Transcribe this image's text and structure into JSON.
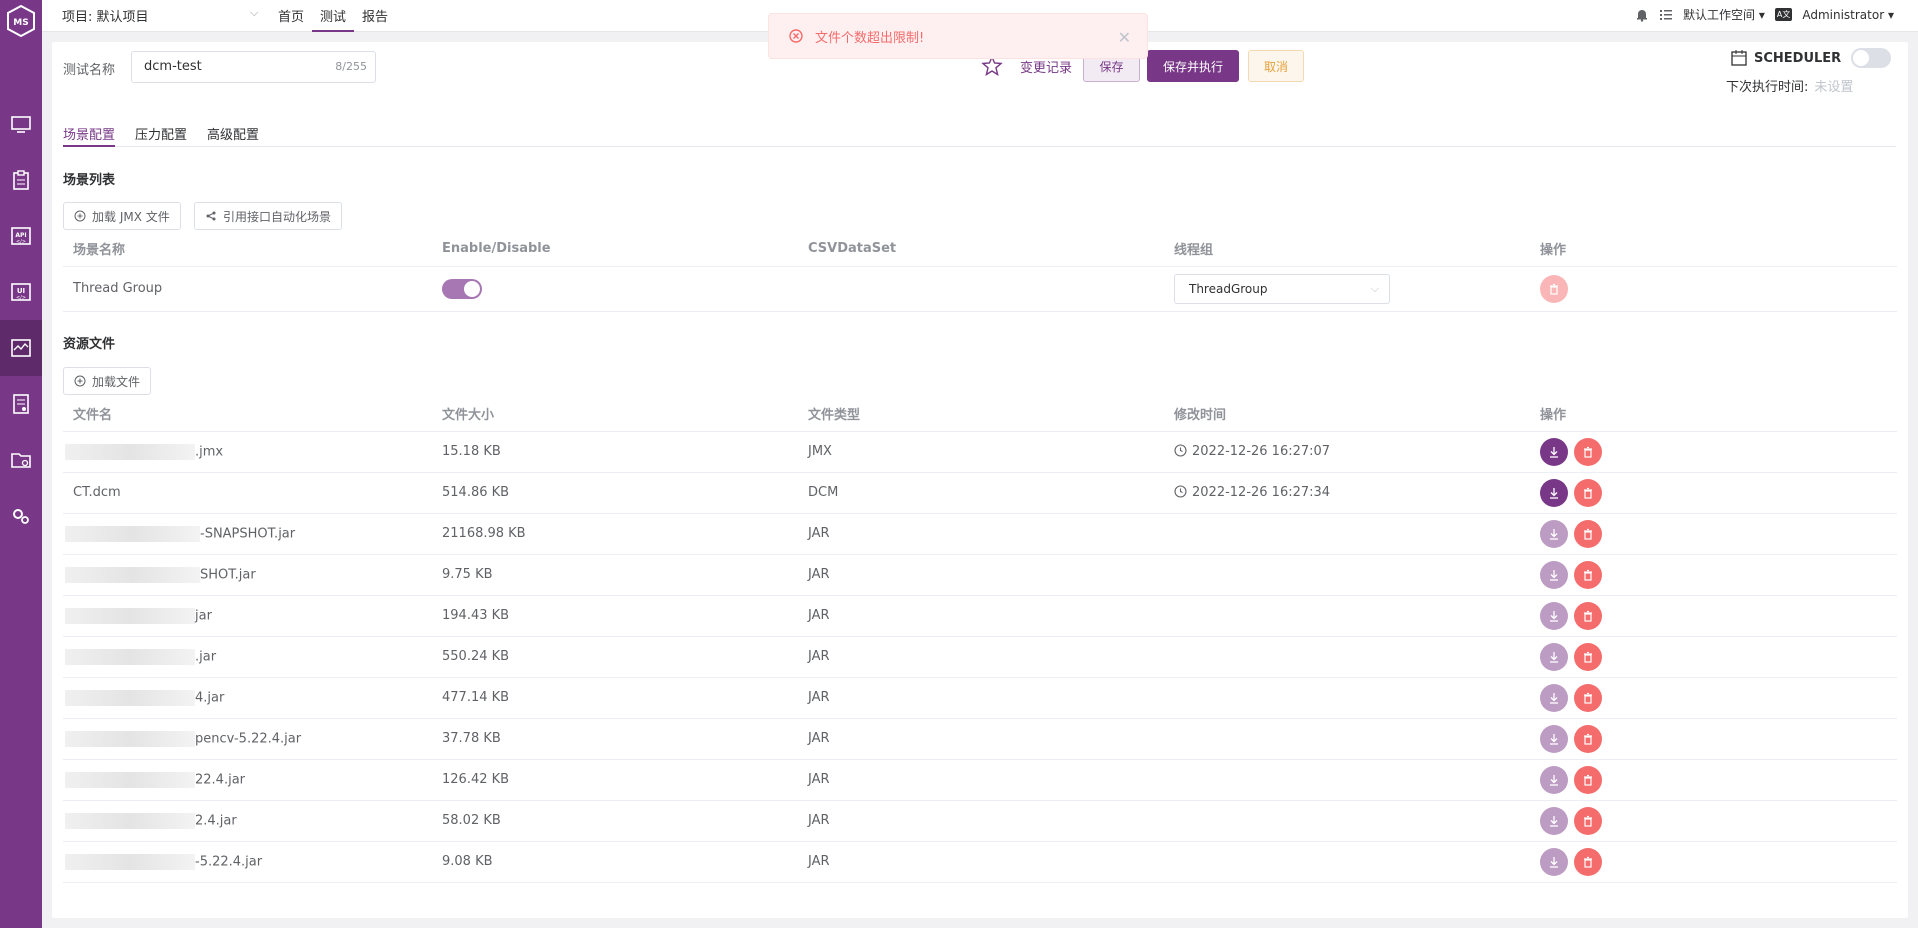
{
  "rail": {
    "logo_text": "MS"
  },
  "topbar": {
    "project_label": "项目: 默认项目",
    "nav": [
      "首页",
      "测试",
      "报告"
    ],
    "workspace": "默认工作空间",
    "user": "Administrator",
    "lang_badge": "A文"
  },
  "alert": {
    "message": "文件个数超出限制!"
  },
  "form": {
    "name_label": "测试名称",
    "name_value": "dcm-test",
    "name_count": "8/255",
    "history_label": "变更记录",
    "save_label": "保存",
    "save_run_label": "保存并执行",
    "cancel_label": "取消"
  },
  "scheduler": {
    "title": "SCHEDULER",
    "next_run_label": "下次执行时间:",
    "next_run_value": "未设置"
  },
  "tabs": [
    "场景配置",
    "压力配置",
    "高级配置"
  ],
  "scenarios": {
    "title": "场景列表",
    "load_jmx_label": "加载 JMX 文件",
    "reference_label": "引用接口自动化场景",
    "headers": [
      "场景名称",
      "Enable/Disable",
      "CSVDataSet",
      "线程组",
      "操作"
    ],
    "rows": [
      {
        "name": "Thread Group",
        "enabled": true,
        "csv": "",
        "thread_group": "ThreadGroup"
      }
    ]
  },
  "resources": {
    "title": "资源文件",
    "load_file_label": "加载文件",
    "headers": [
      "文件名",
      "文件大小",
      "文件类型",
      "修改时间",
      "操作"
    ],
    "rows": [
      {
        "name": ".jmx",
        "size": "15.18 KB",
        "type": "JMX",
        "time": "2022-12-26 16:27:07",
        "downloadable": true
      },
      {
        "name": "CT.dcm",
        "size": "514.86 KB",
        "type": "DCM",
        "time": "2022-12-26 16:27:34",
        "downloadable": true
      },
      {
        "name": "-SNAPSHOT.jar",
        "size": "21168.98 KB",
        "type": "JAR",
        "time": "",
        "downloadable": false
      },
      {
        "name": "SHOT.jar",
        "size": "9.75 KB",
        "type": "JAR",
        "time": "",
        "downloadable": false
      },
      {
        "name": "jar",
        "size": "194.43 KB",
        "type": "JAR",
        "time": "",
        "downloadable": false
      },
      {
        "name": ".jar",
        "size": "550.24 KB",
        "type": "JAR",
        "time": "",
        "downloadable": false
      },
      {
        "name": "4.jar",
        "size": "477.14 KB",
        "type": "JAR",
        "time": "",
        "downloadable": false
      },
      {
        "name": "pencv-5.22.4.jar",
        "size": "37.78 KB",
        "type": "JAR",
        "time": "",
        "downloadable": false
      },
      {
        "name": "22.4.jar",
        "size": "126.42 KB",
        "type": "JAR",
        "time": "",
        "downloadable": false
      },
      {
        "name": "2.4.jar",
        "size": "58.02 KB",
        "type": "JAR",
        "time": "",
        "downloadable": false
      },
      {
        "name": "-5.22.4.jar",
        "size": "9.08 KB",
        "type": "JAR",
        "time": "",
        "downloadable": false
      }
    ]
  },
  "colors": {
    "brand": "#783887",
    "danger": "#f56c6c",
    "warning": "#e6a23c"
  }
}
